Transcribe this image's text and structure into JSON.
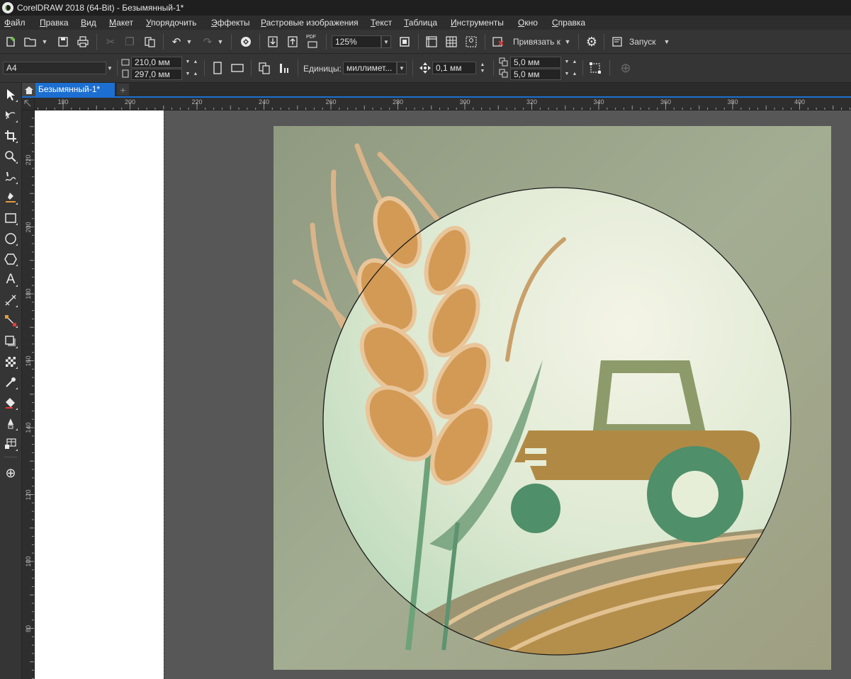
{
  "window": {
    "title": "CorelDRAW 2018 (64-Bit) - Безымянный-1*"
  },
  "menu": [
    {
      "id": "file",
      "label": "Файл"
    },
    {
      "id": "edit",
      "label": "Правка"
    },
    {
      "id": "view",
      "label": "Вид"
    },
    {
      "id": "layout",
      "label": "Макет"
    },
    {
      "id": "arrange",
      "label": "Упорядочить"
    },
    {
      "id": "effects",
      "label": "Эффекты"
    },
    {
      "id": "bitmaps",
      "label": "Растровые изображения"
    },
    {
      "id": "text",
      "label": "Текст"
    },
    {
      "id": "table",
      "label": "Таблица"
    },
    {
      "id": "tools",
      "label": "Инструменты"
    },
    {
      "id": "window",
      "label": "Окно"
    },
    {
      "id": "help",
      "label": "Справка"
    }
  ],
  "toolbar": {
    "pdf_label": "PDF",
    "zoom": "125%",
    "snap_label": "Привязать к",
    "launch_label": "Запуск"
  },
  "property_bar": {
    "page_size": "A4",
    "width": "210,0 мм",
    "height": "297,0 мм",
    "units_label": "Единицы:",
    "units_value": "миллимет...",
    "nudge": "0,1 мм",
    "dup_x": "5,0 мм",
    "dup_y": "5,0 мм"
  },
  "tabs": {
    "document": "Безымянный-1*"
  },
  "rulers": {
    "horizontal": [
      "180",
      "200",
      "220",
      "240",
      "260",
      "280",
      "300",
      "320",
      "340",
      "360",
      "380",
      "400"
    ],
    "vertical": [
      "220",
      "200",
      "180",
      "160",
      "140",
      "120",
      "100",
      "80"
    ]
  },
  "icons": {
    "new": "new-document-icon",
    "open": "open-folder-icon",
    "save": "save-icon",
    "print": "print-icon",
    "undo": "undo-icon",
    "import": "import-icon",
    "export": "export-icon",
    "full_screen": "full-screen-icon",
    "settings": "gear-icon",
    "pick": "pick-tool-icon",
    "shape": "shape-tool-icon",
    "crop": "crop-tool-icon",
    "zoom": "zoom-tool-icon",
    "text": "text-tool-icon"
  },
  "artwork_colors": {
    "background": "#9aa58a",
    "circle": "#e6eed8",
    "wheat": "#d39a55",
    "tractor_body": "#b08a45",
    "tractor_wheel": "#4f8f6a"
  }
}
